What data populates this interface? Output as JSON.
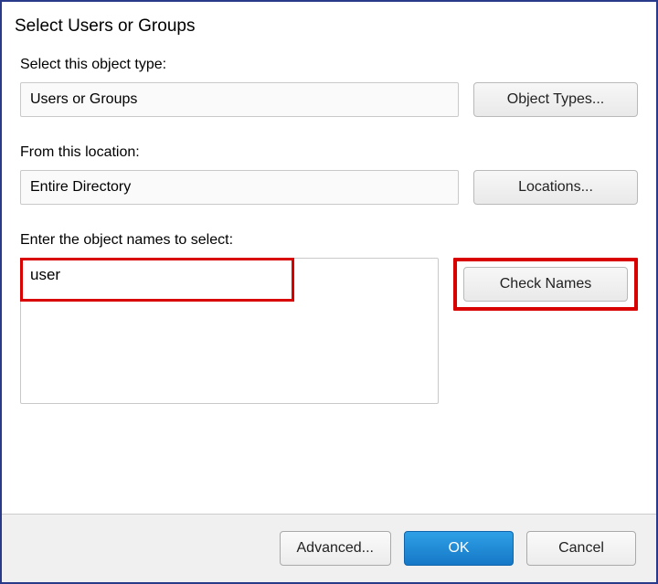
{
  "title": "Select Users or Groups",
  "section1": {
    "label": "Select this object type:",
    "value": "Users or Groups",
    "button": "Object Types..."
  },
  "section2": {
    "label": "From this location:",
    "value": "Entire Directory",
    "button": "Locations..."
  },
  "section3": {
    "label": "Enter the object names to select:",
    "value": "user",
    "button": "Check Names"
  },
  "footer": {
    "advanced": "Advanced...",
    "ok": "OK",
    "cancel": "Cancel"
  }
}
